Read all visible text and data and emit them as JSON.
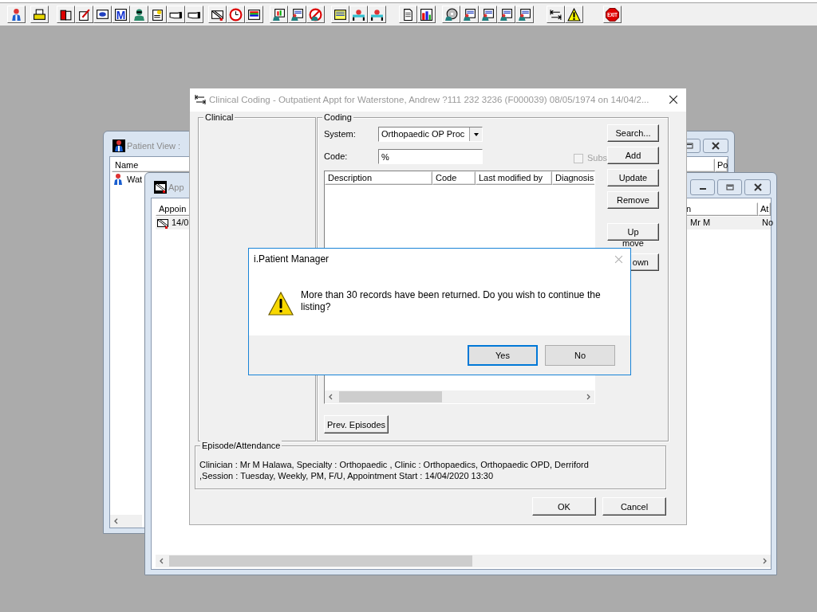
{
  "toolbar": {
    "letter_icon_text": "M",
    "exit_label": "EXIT"
  },
  "patient_view": {
    "title": "Patient View :",
    "columns": [
      {
        "label": "Name"
      },
      {
        "label": "Po"
      }
    ],
    "rows": [
      {
        "name": "Wat"
      }
    ]
  },
  "appointments": {
    "title": "App",
    "columns": [
      {
        "label": "Appoin"
      },
      {
        "label": "n"
      },
      {
        "label": "At"
      }
    ],
    "rows": [
      {
        "cells": [
          "14/0",
          "Mr M",
          "No"
        ],
        "selected": true
      }
    ]
  },
  "clinical_coding": {
    "title": "Clinical Coding - Outpatient Appt for Waterstone, Andrew ?111 232 3236 (F000039) 08/05/1974 on 14/04/2...",
    "clinical_group": "Clinical",
    "coding_group": "Coding",
    "system_label": "System:",
    "system_value": "Orthopaedic OP Proc",
    "code_label": "Code:",
    "code_value": "%",
    "subs": {
      "label": "Subs",
      "checked": false,
      "disabled": true
    },
    "side_buttons": [
      "Search...",
      "Add",
      "Update",
      "Remove",
      "Up"
    ],
    "move_label": "move",
    "down_button": "own",
    "columns": [
      {
        "label": "Description"
      },
      {
        "label": "Code"
      },
      {
        "label": "Last modified by"
      },
      {
        "label": "Diagnosis"
      }
    ],
    "prev_button": "Prev. Episodes",
    "episode_group": "Episode/Attendance",
    "episode_lines": [
      "Clinician :  Mr M Halawa, Specialty : Orthopaedic , Clinic : Orthopaedics, Orthopaedic OPD, Derriford",
      ",Session : Tuesday, Weekly, PM, F/U, Appointment Start : 14/04/2020  13:30"
    ],
    "ok_button": "OK",
    "cancel_button": "Cancel"
  },
  "message_box": {
    "title": "i.Patient Manager",
    "message": "More than 30 records have been returned. Do you wish to continue the listing?",
    "buttons": [
      {
        "label": "Yes",
        "default": true
      },
      {
        "label": "No",
        "default": false
      }
    ]
  }
}
